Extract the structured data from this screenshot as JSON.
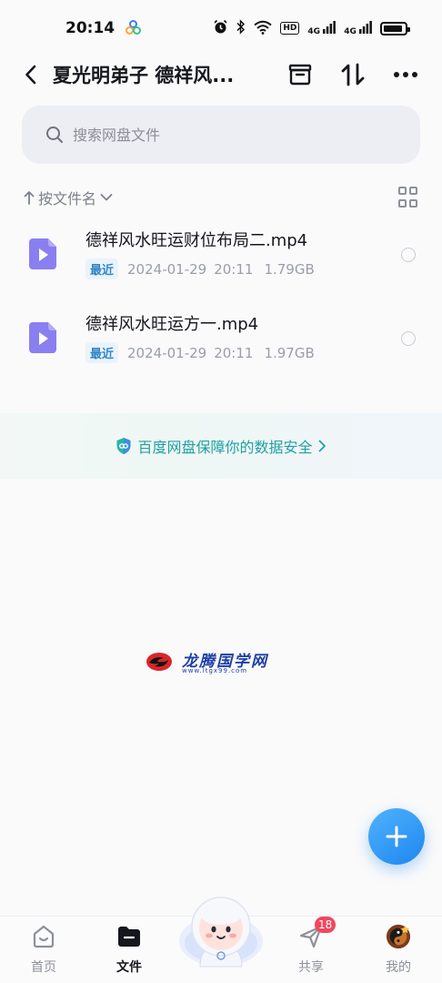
{
  "status_bar": {
    "time": "20:14",
    "icons": [
      "alarm-icon",
      "bluetooth-icon",
      "wifi-icon",
      "hd-icon",
      "signal-4g-icon",
      "signal-4g-icon",
      "battery-icon"
    ],
    "hd_label": "HD",
    "signal_label": "4G"
  },
  "header": {
    "title": "夏光明弟子 德祥风...",
    "icons": [
      "back-icon",
      "archive-icon",
      "sort-transfer-icon",
      "more-icon"
    ]
  },
  "search": {
    "placeholder": "搜索网盘文件"
  },
  "sort": {
    "label": "按文件名"
  },
  "files": [
    {
      "name": "德祥风水旺运财位布局二.mp4",
      "badge": "最近",
      "date": "2024-01-29",
      "time": "20:11",
      "size": "1.79GB",
      "icon": "video-file-icon"
    },
    {
      "name": "德祥风水旺运方一.mp4",
      "badge": "最近",
      "date": "2024-01-29",
      "time": "20:11",
      "size": "1.97GB",
      "icon": "video-file-icon"
    }
  ],
  "security_banner": {
    "text": "百度网盘保障你的数据安全"
  },
  "watermark": {
    "name": "龙腾国学网",
    "url": "www.ltgx99.com"
  },
  "tabbar": {
    "tabs": [
      {
        "label": "首页",
        "icon": "home-icon"
      },
      {
        "label": "文件",
        "icon": "folder-icon",
        "active": true
      },
      {
        "label": "共享",
        "icon": "share-icon",
        "badge": "18"
      },
      {
        "label": "我的",
        "icon": "avatar-icon"
      }
    ]
  },
  "colors": {
    "accent": "#1f86ee",
    "badge_red": "#f2475f",
    "security_teal": "#21a0a4",
    "video_icon": "#8a7ff0"
  }
}
